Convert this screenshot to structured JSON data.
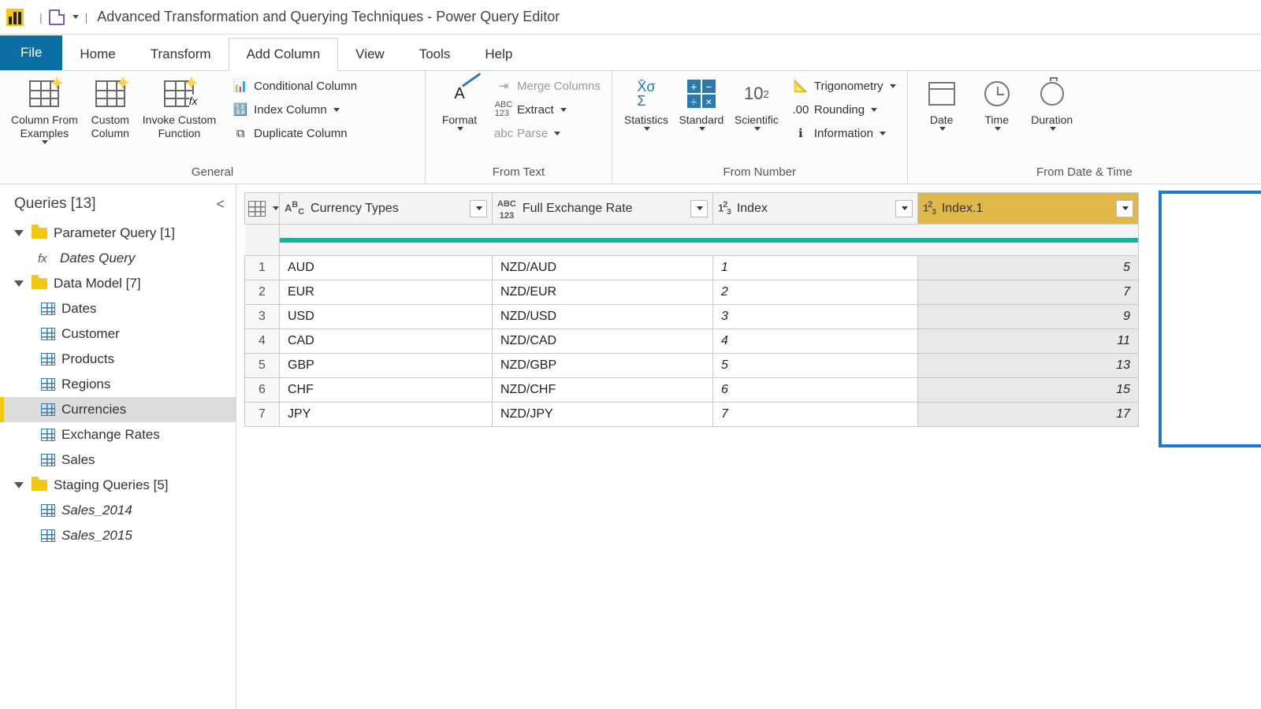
{
  "title": "Advanced Transformation and Querying Techniques - Power Query Editor",
  "tabs": {
    "file": "File",
    "home": "Home",
    "transform": "Transform",
    "addcol": "Add Column",
    "view": "View",
    "tools": "Tools",
    "help": "Help"
  },
  "ribbon": {
    "general": {
      "label": "General",
      "colFromExamples": "Column From\nExamples",
      "customCol": "Custom\nColumn",
      "invokeCustom": "Invoke Custom\nFunction",
      "conditional": "Conditional Column",
      "indexCol": "Index Column",
      "duplicateCol": "Duplicate Column"
    },
    "fromText": {
      "label": "From Text",
      "format": "Format",
      "merge": "Merge Columns",
      "extract": "Extract",
      "parse": "Parse"
    },
    "fromNumber": {
      "label": "From Number",
      "statistics": "Statistics",
      "standard": "Standard",
      "scientific": "Scientific",
      "trig": "Trigonometry",
      "rounding": "Rounding",
      "info": "Information"
    },
    "fromDate": {
      "label": "From Date & Time",
      "date": "Date",
      "time": "Time",
      "duration": "Duration"
    }
  },
  "queries": {
    "header": "Queries [13]",
    "g1": "Parameter Query [1]",
    "g1_i1": "Dates Query",
    "g2": "Data Model [7]",
    "g2_items": [
      "Dates",
      "Customer",
      "Products",
      "Regions",
      "Currencies",
      "Exchange Rates",
      "Sales"
    ],
    "g3": "Staging Queries [5]",
    "g3_items": [
      "Sales_2014",
      "Sales_2015"
    ]
  },
  "gridCols": {
    "c1": "Currency Types",
    "c2": "Full Exchange Rate",
    "c3": "Index",
    "c4": "Index.1"
  },
  "gridRows": [
    {
      "n": "1",
      "ct": "AUD",
      "fx": "NZD/AUD",
      "i": "1",
      "i1": "5"
    },
    {
      "n": "2",
      "ct": "EUR",
      "fx": "NZD/EUR",
      "i": "2",
      "i1": "7"
    },
    {
      "n": "3",
      "ct": "USD",
      "fx": "NZD/USD",
      "i": "3",
      "i1": "9"
    },
    {
      "n": "4",
      "ct": "CAD",
      "fx": "NZD/CAD",
      "i": "4",
      "i1": "11"
    },
    {
      "n": "5",
      "ct": "GBP",
      "fx": "NZD/GBP",
      "i": "5",
      "i1": "13"
    },
    {
      "n": "6",
      "ct": "CHF",
      "fx": "NZD/CHF",
      "i": "6",
      "i1": "15"
    },
    {
      "n": "7",
      "ct": "JPY",
      "fx": "NZD/JPY",
      "i": "7",
      "i1": "17"
    }
  ]
}
